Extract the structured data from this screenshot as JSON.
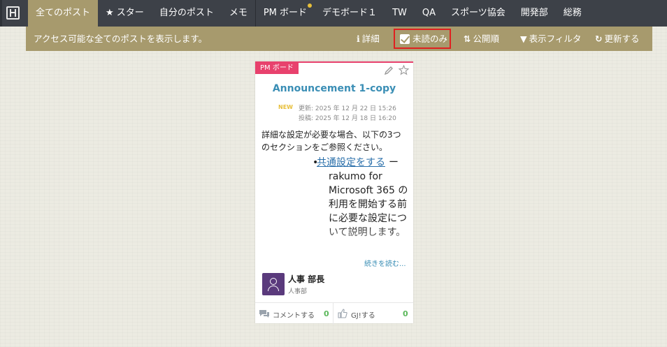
{
  "nav": {
    "tabs": [
      {
        "label": "全てのポスト"
      },
      {
        "label": "★ スター"
      },
      {
        "label": "自分のポスト"
      },
      {
        "label": "メモ"
      },
      {
        "label": "PM ボード"
      },
      {
        "label": "デモボード１"
      },
      {
        "label": "TW"
      },
      {
        "label": "QA"
      },
      {
        "label": "スポーツ協会"
      },
      {
        "label": "開発部"
      },
      {
        "label": "総務"
      }
    ],
    "active_tab": "全てのポスト",
    "notification_tab": "PM ボード"
  },
  "toolbar": {
    "description": "アクセス可能な全てのポストを表示します。",
    "details_label": "詳細",
    "unread_only_label": "未読のみ",
    "unread_only_checked": true,
    "sort_label": "公開順",
    "filter_label": "表示フィルタ",
    "refresh_label": "更新する"
  },
  "post": {
    "board_tag": "PM ボード",
    "title": "Announcement 1-copy",
    "new_badge": "NEW",
    "updated": "更新: 2025 年 12 月 22 日 15:26",
    "posted": "投稿: 2025 年 12 月 18 日 16:20",
    "body_intro": "詳細な設定が必要な場合、以下の3つのセクションをご参照ください。",
    "list_bullet": "•",
    "list_link": "共通設定をする",
    "list_dash": "ー",
    "list_rest": "rakumo for Microsoft 365 の利用を開始する前に必要な設定について説明します。",
    "read_more": "続きを読む...",
    "author_name": "人事 部長",
    "author_dept": "人事部",
    "comment_label": "コメントする",
    "comment_count": "0",
    "gj_label": "GJ!する",
    "gj_count": "0"
  },
  "icons": {
    "app": "layout-icon",
    "details": "info-icon",
    "sort": "sort-icon",
    "filter": "funnel-icon",
    "refresh": "refresh-icon",
    "edit": "pencil-icon",
    "favorite": "star-icon",
    "avatar": "user-icon",
    "comment": "comment-icon",
    "gj": "thumbs-up-icon"
  },
  "colors": {
    "nav_bg": "#3d4148",
    "accent": "#a79a6d",
    "board_tag": "#e8416d",
    "title": "#3a8eb5",
    "count": "#5cb85c",
    "highlight_box": "#e02020"
  }
}
